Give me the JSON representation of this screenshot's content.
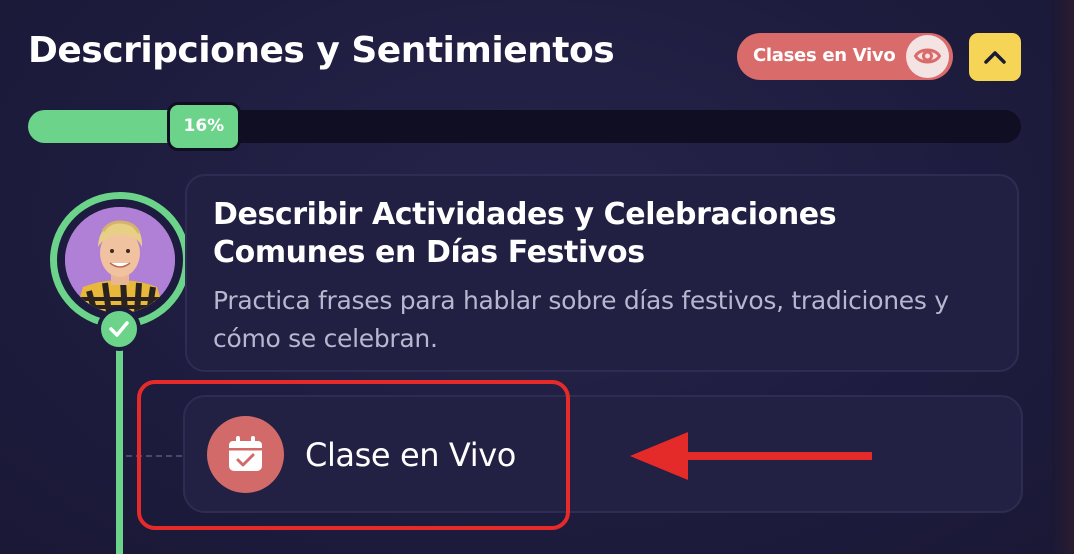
{
  "header": {
    "title": "Descripciones y Sentimientos",
    "live_pill_label": "Clases en Vivo",
    "live_pill_icon": "eye-icon",
    "collapse_icon": "chevron-up-icon"
  },
  "progress": {
    "value_percent": 16,
    "label": "16%"
  },
  "lesson": {
    "title": "Describir Actividades y Celebraciones Comunes en Días Festivos",
    "description": "Practica frases para hablar sobre días festivos, tradiciones y cómo se celebran.",
    "status": "completed",
    "status_icon": "check-icon"
  },
  "live_class": {
    "label": "Clase en Vivo",
    "icon": "calendar-check-icon"
  },
  "colors": {
    "background": "#1e1c3e",
    "accent_green": "#6bd38a",
    "live_red": "#d96b6b",
    "collapse_yellow": "#f5d456",
    "annotation_red": "#e52a2a"
  }
}
